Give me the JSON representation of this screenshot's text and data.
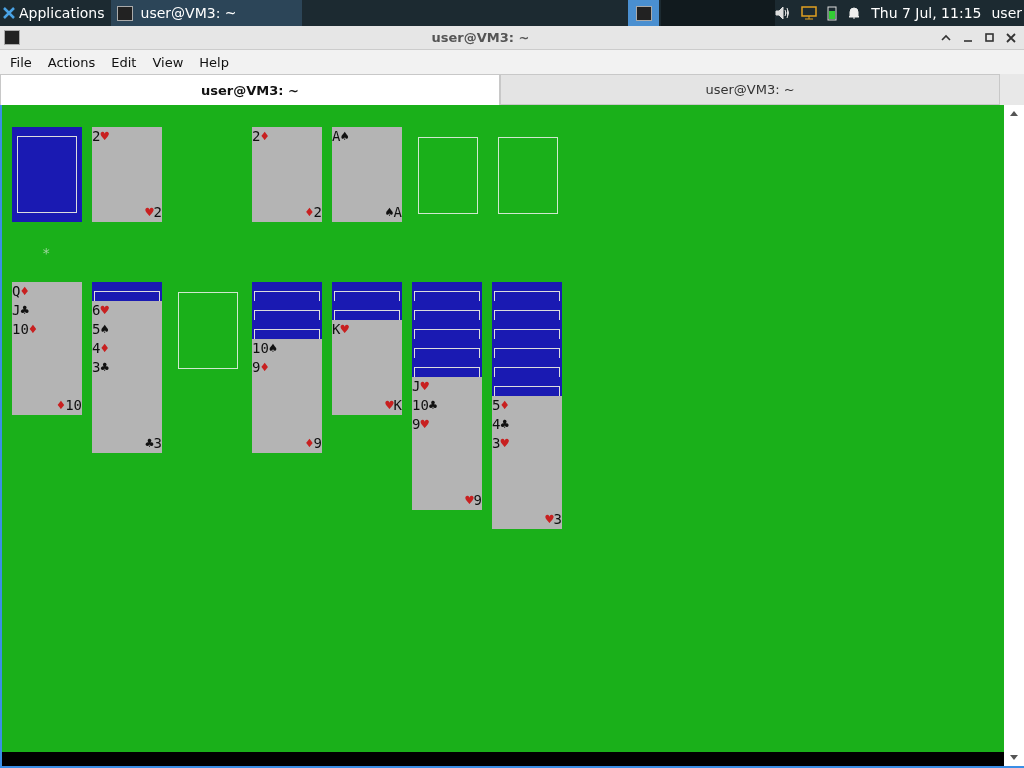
{
  "panel": {
    "apps_label": "Applications",
    "tasks": [
      {
        "label": "user@VM3: ~",
        "selected": true
      }
    ],
    "clock": "Thu  7 Jul, 11:15",
    "user": "user"
  },
  "window": {
    "title": "user@VM3: ~"
  },
  "menu": [
    "File",
    "Actions",
    "Edit",
    "View",
    "Help"
  ],
  "tabs": [
    {
      "label": "user@VM3: ~",
      "selected": true
    },
    {
      "label": "user@VM3: ~",
      "selected": false
    }
  ],
  "game": {
    "top": [
      {
        "kind": "stock"
      },
      {
        "kind": "card",
        "rank": "2",
        "suit": "♥",
        "red": true,
        "corner_rank": "2",
        "corner_suit": "♥"
      },
      {
        "kind": "gap"
      },
      {
        "kind": "card",
        "rank": "2",
        "suit": "♦",
        "red": true,
        "corner_rank": "2",
        "corner_suit": "♦"
      },
      {
        "kind": "card",
        "rank": "A",
        "suit": "♠",
        "red": false,
        "corner_rank": "A",
        "corner_suit": "♠"
      },
      {
        "kind": "slot"
      },
      {
        "kind": "slot"
      }
    ],
    "marker": "*",
    "tableau": [
      {
        "kind": "pile",
        "cards": [
          {
            "face_up": true,
            "rank": "Q",
            "suit": "♦",
            "red": true
          },
          {
            "face_up": true,
            "rank": "J",
            "suit": "♣",
            "red": false
          },
          {
            "face_up": true,
            "rank": "10",
            "suit": "♦",
            "red": true,
            "corner_rank": "10",
            "corner_suit": "♦"
          }
        ]
      },
      {
        "kind": "pile",
        "cards": [
          {
            "face_up": false
          },
          {
            "face_up": true,
            "rank": "6",
            "suit": "♥",
            "red": true
          },
          {
            "face_up": true,
            "rank": "5",
            "suit": "♠",
            "red": false
          },
          {
            "face_up": true,
            "rank": "4",
            "suit": "♦",
            "red": true
          },
          {
            "face_up": true,
            "rank": "3",
            "suit": "♣",
            "red": false,
            "corner_rank": "3",
            "corner_suit": "♣"
          }
        ]
      },
      {
        "kind": "slot"
      },
      {
        "kind": "pile",
        "cards": [
          {
            "face_up": false
          },
          {
            "face_up": false
          },
          {
            "face_up": false
          },
          {
            "face_up": true,
            "rank": "10",
            "suit": "♠",
            "red": false
          },
          {
            "face_up": true,
            "rank": "9",
            "suit": "♦",
            "red": true,
            "corner_rank": "9",
            "corner_suit": "♦"
          }
        ]
      },
      {
        "kind": "pile",
        "cards": [
          {
            "face_up": false
          },
          {
            "face_up": false
          },
          {
            "face_up": true,
            "rank": "K",
            "suit": "♥",
            "red": true,
            "corner_rank": "K",
            "corner_suit": "♥"
          }
        ]
      },
      {
        "kind": "pile",
        "cards": [
          {
            "face_up": false
          },
          {
            "face_up": false
          },
          {
            "face_up": false
          },
          {
            "face_up": false
          },
          {
            "face_up": false
          },
          {
            "face_up": true,
            "rank": "J",
            "suit": "♥",
            "red": true
          },
          {
            "face_up": true,
            "rank": "10",
            "suit": "♣",
            "red": false
          },
          {
            "face_up": true,
            "rank": "9",
            "suit": "♥",
            "red": true,
            "corner_rank": "9",
            "corner_suit": "♥"
          }
        ]
      },
      {
        "kind": "pile",
        "cards": [
          {
            "face_up": false
          },
          {
            "face_up": false
          },
          {
            "face_up": false
          },
          {
            "face_up": false
          },
          {
            "face_up": false
          },
          {
            "face_up": false
          },
          {
            "face_up": true,
            "rank": "5",
            "suit": "♦",
            "red": true
          },
          {
            "face_up": true,
            "rank": "4",
            "suit": "♣",
            "red": false
          },
          {
            "face_up": true,
            "rank": "3",
            "suit": "♥",
            "red": true,
            "corner_rank": "3",
            "corner_suit": "♥"
          }
        ]
      }
    ]
  }
}
